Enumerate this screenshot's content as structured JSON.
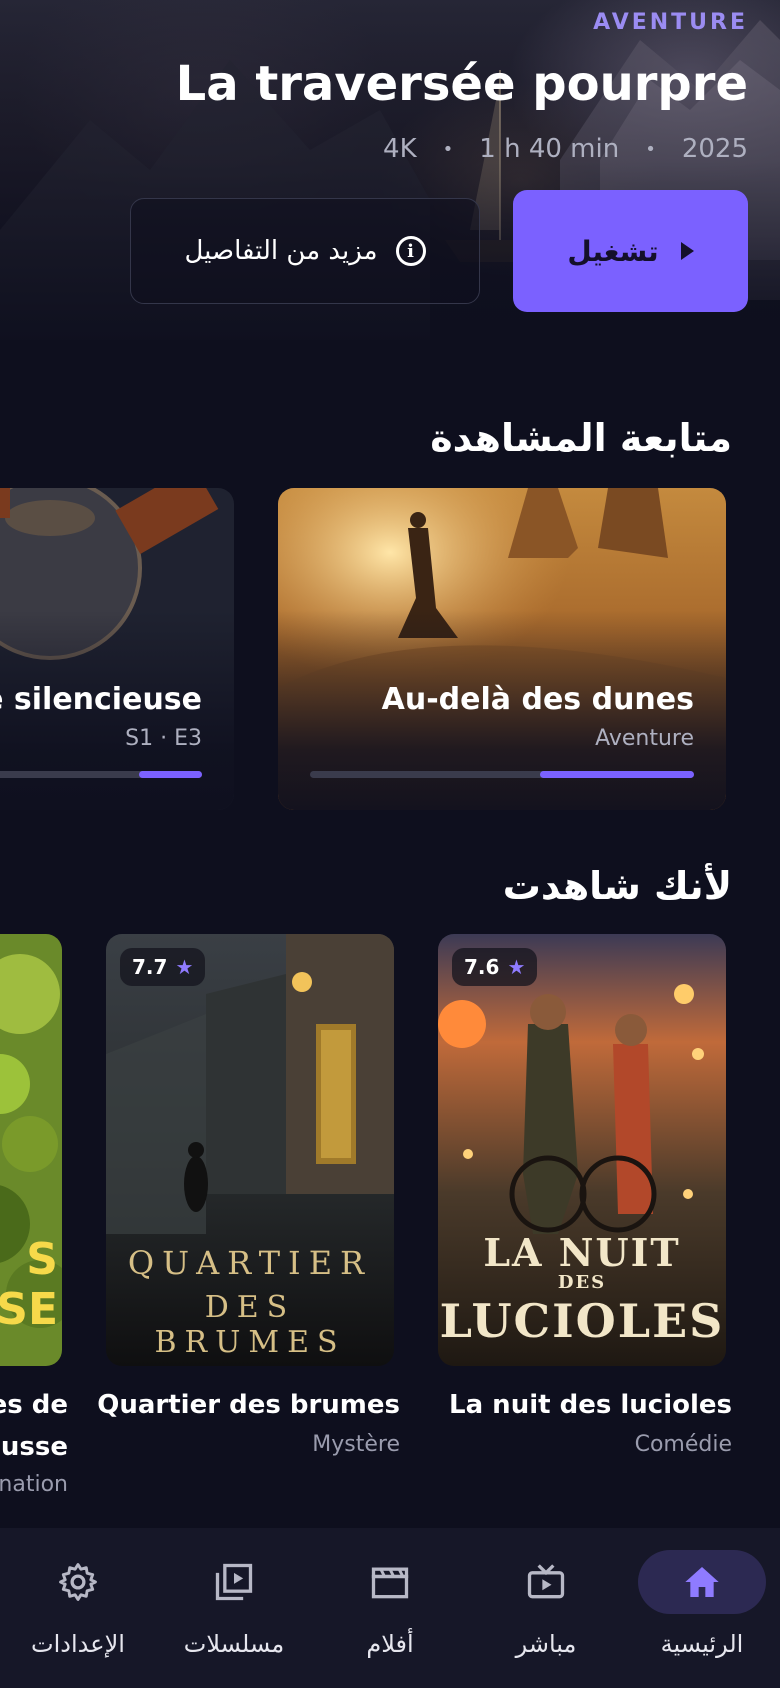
{
  "hero": {
    "genre": "AVENTURE",
    "title": "La traversée pourpre",
    "meta": [
      "4K",
      "1 h 40 min",
      "2025"
    ],
    "play_label": "تشغيل",
    "more_label": "مزيد من التفاصيل"
  },
  "continue_watching": {
    "title": "متابعة المشاهدة",
    "items": [
      {
        "title": "Au-delà des dunes",
        "subtitle": "Aventure",
        "progress": 0.4
      },
      {
        "title": "te silencieuse",
        "subtitle": "S1 · E3",
        "progress": 0.3
      }
    ]
  },
  "because_watched": {
    "title": "لأنك شاهدت",
    "items": [
      {
        "title": "La nuit des lucioles",
        "genre": "Comédie",
        "rating": "7.6",
        "poster_text": [
          "LA NUIT",
          "DES",
          "LUCIOLES"
        ]
      },
      {
        "title": "Quartier des brumes",
        "genre": "Mystère",
        "rating": "7.7",
        "poster_text": [
          "QUARTIER",
          "DES BRUMES"
        ]
      },
      {
        "title_lines": [
          "es de",
          "ousse"
        ],
        "genre": "nation",
        "poster_text": [
          "S",
          "SE"
        ]
      }
    ]
  },
  "nav": {
    "items": [
      {
        "label": "الرئيسية",
        "icon": "home-icon",
        "active": true
      },
      {
        "label": "مباشر",
        "icon": "live-tv-icon",
        "active": false
      },
      {
        "label": "أفلام",
        "icon": "clapperboard-icon",
        "active": false
      },
      {
        "label": "مسلسلات",
        "icon": "video-library-icon",
        "active": false
      },
      {
        "label": "الإعدادات",
        "icon": "gear-icon",
        "active": false
      }
    ]
  },
  "colors": {
    "accent": "#7b61ff",
    "background": "#0e0f1e",
    "nav_background": "#161728"
  }
}
